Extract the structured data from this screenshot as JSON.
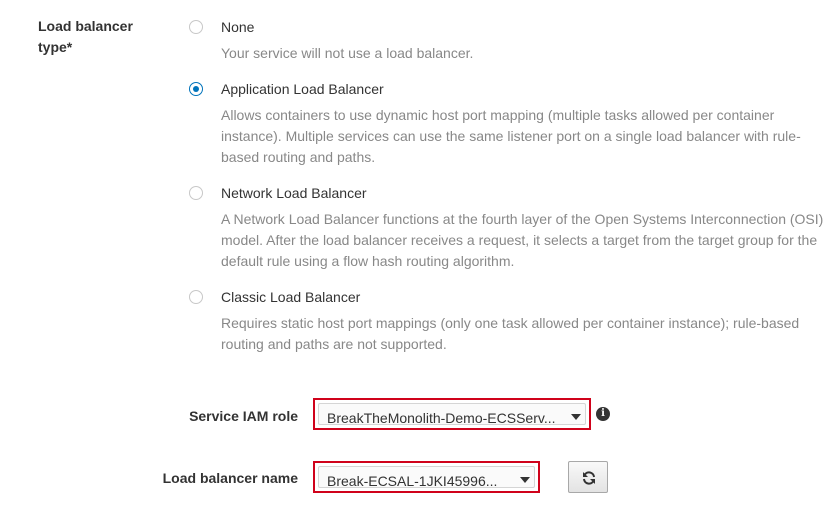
{
  "load_balancer_type": {
    "label": "Load balancer type*",
    "options": [
      {
        "title": "None",
        "description": "Your service will not use a load balancer.",
        "selected": false
      },
      {
        "title": "Application Load Balancer",
        "description": "Allows containers to use dynamic host port mapping (multiple tasks allowed per container instance). Multiple services can use the same listener port on a single load balancer with rule-based routing and paths.",
        "selected": true
      },
      {
        "title": "Network Load Balancer",
        "description": "A Network Load Balancer functions at the fourth layer of the Open Systems Interconnection (OSI) model. After the load balancer receives a request, it selects a target from the target group for the default rule using a flow hash routing algorithm.",
        "selected": false
      },
      {
        "title": "Classic Load Balancer",
        "description": "Requires static host port mappings (only one task allowed per container instance); rule-based routing and paths are not supported.",
        "selected": false
      }
    ]
  },
  "service_iam_role": {
    "label": "Service IAM role",
    "value": "BreakTheMonolith-Demo-ECSServ...",
    "icon": "info-icon"
  },
  "load_balancer_name": {
    "label": "Load balancer name",
    "value": "Break-ECSAL-1JKI45996...",
    "icon": "refresh-icon"
  },
  "colors": {
    "accent": "#0073bb",
    "highlight_border": "#d0021b"
  }
}
